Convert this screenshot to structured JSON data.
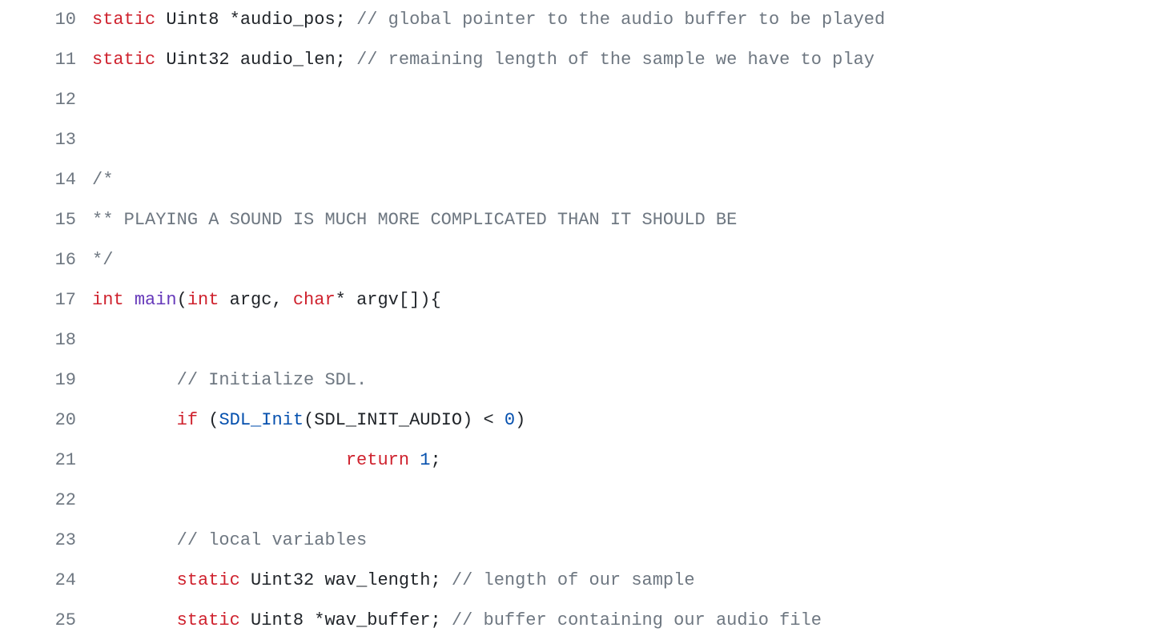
{
  "lines": [
    {
      "num": "10",
      "tokens": [
        {
          "cls": "kw",
          "text": "static"
        },
        {
          "cls": "plain",
          "text": " Uint8 *audio_pos; "
        },
        {
          "cls": "comment",
          "text": "// global pointer to the audio buffer to be played"
        }
      ]
    },
    {
      "num": "11",
      "tokens": [
        {
          "cls": "kw",
          "text": "static"
        },
        {
          "cls": "plain",
          "text": " Uint32 audio_len; "
        },
        {
          "cls": "comment",
          "text": "// remaining length of the sample we have to play"
        }
      ]
    },
    {
      "num": "12",
      "tokens": []
    },
    {
      "num": "13",
      "tokens": []
    },
    {
      "num": "14",
      "tokens": [
        {
          "cls": "comment",
          "text": "/*"
        }
      ]
    },
    {
      "num": "15",
      "tokens": [
        {
          "cls": "comment",
          "text": "** PLAYING A SOUND IS MUCH MORE COMPLICATED THAN IT SHOULD BE"
        }
      ]
    },
    {
      "num": "16",
      "tokens": [
        {
          "cls": "comment",
          "text": "*/"
        }
      ]
    },
    {
      "num": "17",
      "tokens": [
        {
          "cls": "kw",
          "text": "int"
        },
        {
          "cls": "plain",
          "text": " "
        },
        {
          "cls": "ident",
          "text": "main"
        },
        {
          "cls": "plain",
          "text": "("
        },
        {
          "cls": "kw",
          "text": "int"
        },
        {
          "cls": "plain",
          "text": " argc, "
        },
        {
          "cls": "kw",
          "text": "char"
        },
        {
          "cls": "plain",
          "text": "* argv[]){"
        }
      ]
    },
    {
      "num": "18",
      "tokens": []
    },
    {
      "num": "19",
      "tokens": [
        {
          "cls": "plain",
          "text": "        "
        },
        {
          "cls": "comment",
          "text": "// Initialize SDL."
        }
      ]
    },
    {
      "num": "20",
      "tokens": [
        {
          "cls": "plain",
          "text": "        "
        },
        {
          "cls": "kw",
          "text": "if"
        },
        {
          "cls": "plain",
          "text": " ("
        },
        {
          "cls": "fn",
          "text": "SDL_Init"
        },
        {
          "cls": "plain",
          "text": "(SDL_INIT_AUDIO) < "
        },
        {
          "cls": "num",
          "text": "0"
        },
        {
          "cls": "plain",
          "text": ")"
        }
      ]
    },
    {
      "num": "21",
      "tokens": [
        {
          "cls": "plain",
          "text": "                        "
        },
        {
          "cls": "kw",
          "text": "return"
        },
        {
          "cls": "plain",
          "text": " "
        },
        {
          "cls": "num",
          "text": "1"
        },
        {
          "cls": "plain",
          "text": ";"
        }
      ]
    },
    {
      "num": "22",
      "tokens": []
    },
    {
      "num": "23",
      "tokens": [
        {
          "cls": "plain",
          "text": "        "
        },
        {
          "cls": "comment",
          "text": "// local variables"
        }
      ]
    },
    {
      "num": "24",
      "tokens": [
        {
          "cls": "plain",
          "text": "        "
        },
        {
          "cls": "kw",
          "text": "static"
        },
        {
          "cls": "plain",
          "text": " Uint32 wav_length; "
        },
        {
          "cls": "comment",
          "text": "// length of our sample"
        }
      ]
    },
    {
      "num": "25",
      "tokens": [
        {
          "cls": "plain",
          "text": "        "
        },
        {
          "cls": "kw",
          "text": "static"
        },
        {
          "cls": "plain",
          "text": " Uint8 *wav_buffer; "
        },
        {
          "cls": "comment",
          "text": "// buffer containing our audio file"
        }
      ]
    }
  ]
}
